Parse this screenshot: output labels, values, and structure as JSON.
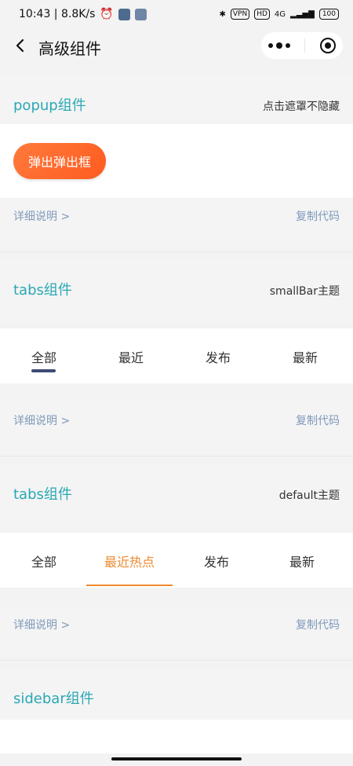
{
  "status": {
    "time_speed": "10:43 | 8.8K/s",
    "vpn": "VPN",
    "hd": "HD",
    "network": "4G",
    "battery": "100"
  },
  "topbar": {
    "title": "高级组件"
  },
  "sections": {
    "popup": {
      "title": "popup组件",
      "note": "点击遮罩不隐藏",
      "button": "弹出弹出框",
      "detail": "详细说明 >",
      "copy": "复制代码"
    },
    "tabs_small": {
      "title": "tabs组件",
      "note": "smallBar主题",
      "tabs": [
        "全部",
        "最近",
        "发布",
        "最新"
      ],
      "detail": "详细说明 >",
      "copy": "复制代码"
    },
    "tabs_default": {
      "title": "tabs组件",
      "note": "default主题",
      "tabs": [
        "全部",
        "最近热点",
        "发布",
        "最新"
      ],
      "detail": "详细说明 >",
      "copy": "复制代码"
    },
    "sidebar": {
      "title": "sidebar组件"
    }
  }
}
